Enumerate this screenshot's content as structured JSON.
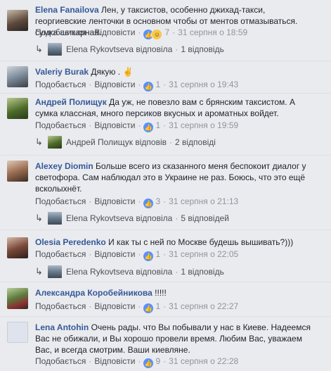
{
  "actions": {
    "like": "Подобається",
    "reply": "Відповісти",
    "dot": "·"
  },
  "colors": {
    "name": "#365899",
    "meta": "#90949c",
    "like_icon": "#5890ff",
    "background": "#e9ebee"
  },
  "comments": [
    {
      "name": "Elena Fanailova",
      "text": "Лен, у таксистов, особенно джихад-такси, георгиевские ленточки в основном чтобы от ментов отмазываться. сумка шикарная.",
      "reactions": "7",
      "time": "31 серпня о 18:59",
      "reply_by": "Elena Rykovtseva відповіла",
      "reply_count": "1 відповідь"
    },
    {
      "name": "Valeriy Burak",
      "text": "Дякую .",
      "emoji": "✌",
      "reactions": "1",
      "time": "31 серпня о 19:43"
    },
    {
      "name": "Андрей Полищук",
      "text": "Да уж, не повезло вам с брянским таксистом. А сумка классная, много персиков вкусных и ароматных войдет.",
      "reactions": "1",
      "time": "31 серпня о 19:59",
      "reply_by": "Андрей Полищук відповів",
      "reply_count": "2 відповіді"
    },
    {
      "name": "Alexey Diomin",
      "text": "Больше всего из сказанного меня беспокоит диалог у светофора. Сам наблюдал это в Украине не раз. Боюсь, что это ещё всколыхнёт.",
      "reactions": "3",
      "time": "31 серпня о 21:13",
      "reply_by": "Elena Rykovtseva відповіла",
      "reply_count": "5 відповідей"
    },
    {
      "name": "Olesia Peredenko",
      "text": "И как ты с ней по Москве будешь вышивать?)))",
      "reactions": "1",
      "time": "31 серпня о 22:05",
      "reply_by": "Elena Rykovtseva відповіла",
      "reply_count": "1 відповідь"
    },
    {
      "name": "Александра Коробейникова",
      "text": "!!!!!",
      "reactions": "1",
      "time": "31 серпня о 22:27"
    },
    {
      "name": "Lena Antohin",
      "text": "Очень рады. что Вы побывали у нас в Киеве. Надеемся Вас не обижали, и Вы хорошо провели время. Любим Вас, уважаем Вас, и всегда смотрим. Ваши киевляне.",
      "reactions": "9",
      "time": "31 серпня о 22:28"
    }
  ]
}
